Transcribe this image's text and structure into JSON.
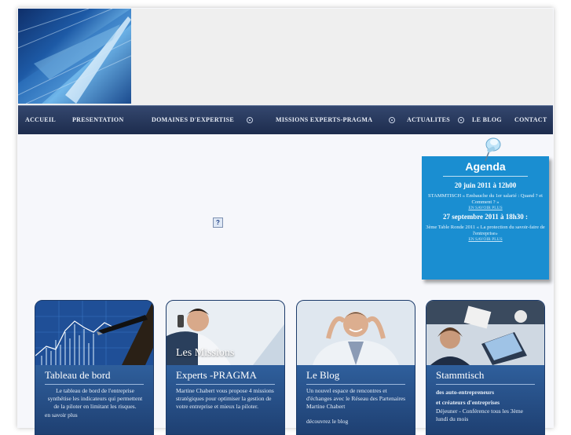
{
  "nav": {
    "items": [
      "ACCUEIL",
      "PRESENTATION",
      "DOMAINES D'EXPERTISE",
      "MISSIONS EXPERTS-PRAGMA",
      "ACTUALITES",
      "LE BLOG",
      "CONTACT"
    ]
  },
  "placeholder_icon": "?",
  "agenda": {
    "title": "Agenda",
    "events": [
      {
        "date": "20 juin 2011 à 12h00",
        "text": "STAMMTISCH « Embauche du 1er salarié : Quand ? et Comment ? »",
        "link": "EN SAVOIR PLUS"
      },
      {
        "date": "27 septembre 2011 à 18h30 :",
        "text": "3ème Table Ronde 2011 « La protection du savoir-faire de l'entreprise»",
        "link": "EN SAVOIR PLUS"
      }
    ]
  },
  "cards": [
    {
      "title": "Tableau de bord",
      "text": "Le tableau de bord de l'entreprise synthétise les indicateurs qui permettent de la piloter en limitant les risques.",
      "more": "en savoir plus"
    },
    {
      "overlay": "Les Missions",
      "title": "Experts -PRAGMA",
      "text": "Martine Chabert vous propose 4 missions stratégiques pour optimiser la gestion de votre entreprise et mieux la piloter."
    },
    {
      "title": "Le Blog",
      "text": "Un nouvel espace de rencontres et d'échanges avec le Réseau des Partenaires Martine Chabert",
      "more": "découvrez le blog"
    },
    {
      "title": "Stammtisch",
      "bold_lines": [
        "des auto-entrepreneurs",
        "et créateurs d'entreprises"
      ],
      "text": "Déjeuner - Conférence tous les 3ème lundi du mois"
    }
  ],
  "colors": {
    "nav": "#1d2c4d",
    "agenda": "#1a8ed1",
    "card": "#254b82"
  }
}
